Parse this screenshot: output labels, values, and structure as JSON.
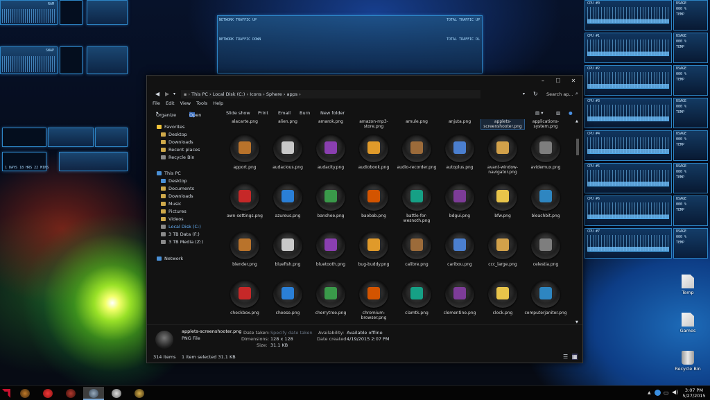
{
  "colors": {
    "accent": "#2d85c6",
    "selection": "#6ab6ff",
    "amd": "#c8102e"
  },
  "explorer": {
    "breadcrumb": [
      "This PC",
      "Local Disk (C:)",
      "Icons",
      "Sphere",
      "apps"
    ],
    "search_placeholder": "Search ap...",
    "menu": [
      "File",
      "Edit",
      "View",
      "Tools",
      "Help"
    ],
    "toolbar": {
      "organize": "Organize",
      "open": "Open",
      "slideshow": "Slide show",
      "print": "Print",
      "email": "Email",
      "burn": "Burn",
      "new_folder": "New folder"
    },
    "nav": {
      "favorites": "Favorites",
      "desktop": "Desktop",
      "downloads": "Downloads",
      "recent": "Recent places",
      "recycle": "Recycle Bin",
      "thispc": "This PC",
      "pc_desktop": "Desktop",
      "documents": "Documents",
      "pc_downloads": "Downloads",
      "music": "Music",
      "pictures": "Pictures",
      "videos": "Videos",
      "local": "Local Disk (C:)",
      "data": "3 TB Data (F:)",
      "media": "3 TB Media (Z:)",
      "network": "Network"
    },
    "top_row": [
      "alacarte.png",
      "alien.png",
      "amarok.png",
      "amazon-mp3-store.png",
      "amule.png",
      "anjuta.png",
      "applets-screenshooter.png",
      "applications-system.png"
    ],
    "rows": [
      [
        "apport.png",
        "audacious.png",
        "audacity.png",
        "audiobook.png",
        "audio-recorder.png",
        "autoplus.png",
        "avant-window-navigator.png",
        "avidemux.png"
      ],
      [
        "awn-settings.png",
        "azureus.png",
        "banshee.png",
        "baobab.png",
        "battle-for-wesnoth.png",
        "bdgui.png",
        "bfw.png",
        "bleachbit.png"
      ],
      [
        "blender.png",
        "bluefish.png",
        "bluetooth.png",
        "bug-buddy.png",
        "calibre.png",
        "caribou.png",
        "ccc_large.png",
        "celestia.png"
      ],
      [
        "checkbox.png",
        "cheese.png",
        "cherrytree.png",
        "chromium-browser.png",
        "clamtk.png",
        "clementine.png",
        "clock.png",
        "computerjanitor.png"
      ]
    ],
    "details": {
      "name": "applets-screenshooter.png",
      "type": "PNG File",
      "date_taken_label": "Date taken:",
      "date_taken": "Specify date taken",
      "dimensions_label": "Dimensions:",
      "dimensions": "128 x 128",
      "size_label": "Size:",
      "size": "31.1 KB",
      "availability_label": "Availability:",
      "availability": "Available offline",
      "created_label": "Date created:",
      "created": "4/19/2015 2:07 PM"
    },
    "status": {
      "items": "314 items",
      "selected": "1 item selected  31.1 KB"
    }
  },
  "desktop_icons": {
    "temp": "Temp",
    "games": "Games",
    "recycle": "Recycle Bin"
  },
  "taskbar": {
    "time": "3:07 PM",
    "date": "5/27/2015"
  },
  "widgets": {
    "ram": "RAM",
    "swap": "SWAP",
    "network_up": "NETWORK TRAFFIC UP",
    "network_down": "NETWORK TRAFFIC DOWN",
    "total_up": "TOTAL TRAFFIC UP",
    "total_down": "TOTAL TRAFFIC DL",
    "uptime": "1 DAYS 18 HRS 22 MINS",
    "cpu_labels": [
      "CPU #0",
      "CPU #1",
      "CPU #2",
      "CPU #3",
      "CPU #4",
      "CPU #5",
      "CPU #6",
      "CPU #7"
    ],
    "usage": "USAGE",
    "pct": "000 %",
    "temp": "TEMP",
    "temp_val": "0.0C"
  }
}
